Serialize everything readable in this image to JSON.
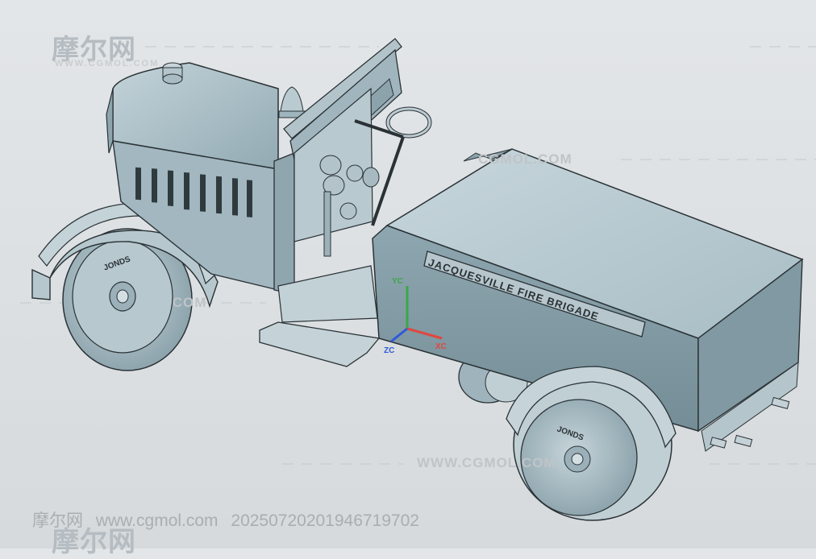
{
  "watermark": {
    "logo_text": "摩尔网",
    "logo_sub": "WWW.CGMOL.COM",
    "url_text": "WWW.CGMOL.COM",
    "url_text_short": "CGMOL.COM",
    "mid_text": ".COM"
  },
  "vehicle": {
    "side_plate": "JACQUESVILLE FIRE BRIGADE",
    "hub_text": "JONDS"
  },
  "axes": {
    "y_label": "YC",
    "z_label": "ZC",
    "x_label": "XC"
  },
  "footer": {
    "site": "摩尔网",
    "url": "www.cgmol.com",
    "id": "20250720201946719702"
  },
  "colors": {
    "background": "#dfe2e4",
    "model_base": "#a4b9c2",
    "model_light": "#c5d4da",
    "model_dark": "#6f8790",
    "edge": "#2a3236",
    "axis_x": "#e2463f",
    "axis_y": "#3aa84a",
    "axis_z": "#2f59d8"
  }
}
